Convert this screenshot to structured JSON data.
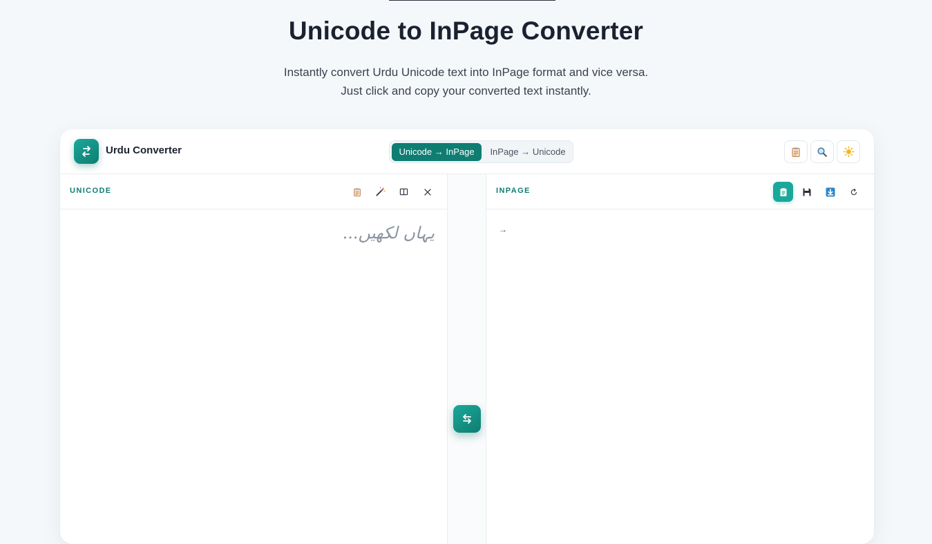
{
  "hero": {
    "title": "Unicode to InPage Converter",
    "subtitle_line1": "Instantly convert Urdu Unicode text into InPage format and vice versa.",
    "subtitle_line2": "Just click and copy your converted text instantly."
  },
  "app": {
    "brand_name": "Urdu Converter",
    "modes": [
      "Unicode → InPage",
      "InPage → Unicode"
    ],
    "active_mode": "Unicode → InPage",
    "header_icons": [
      "clipboard-icon",
      "search-icon",
      "sun-icon"
    ]
  },
  "left_pane": {
    "label": "UNICODE",
    "placeholder": "یہاں لکھیں...",
    "value": "",
    "tools": [
      "clipboard-icon",
      "magic-wand-icon",
      "split-view-icon",
      "close-icon"
    ]
  },
  "right_pane": {
    "label": "INPAGE",
    "output_text": "→",
    "tools": [
      "copy-icon",
      "save-icon",
      "download-icon",
      "reset-icon"
    ]
  },
  "colors": {
    "accent": "#0f7d72",
    "accent_light": "#1aa89a",
    "background": "#f5f8fa"
  }
}
